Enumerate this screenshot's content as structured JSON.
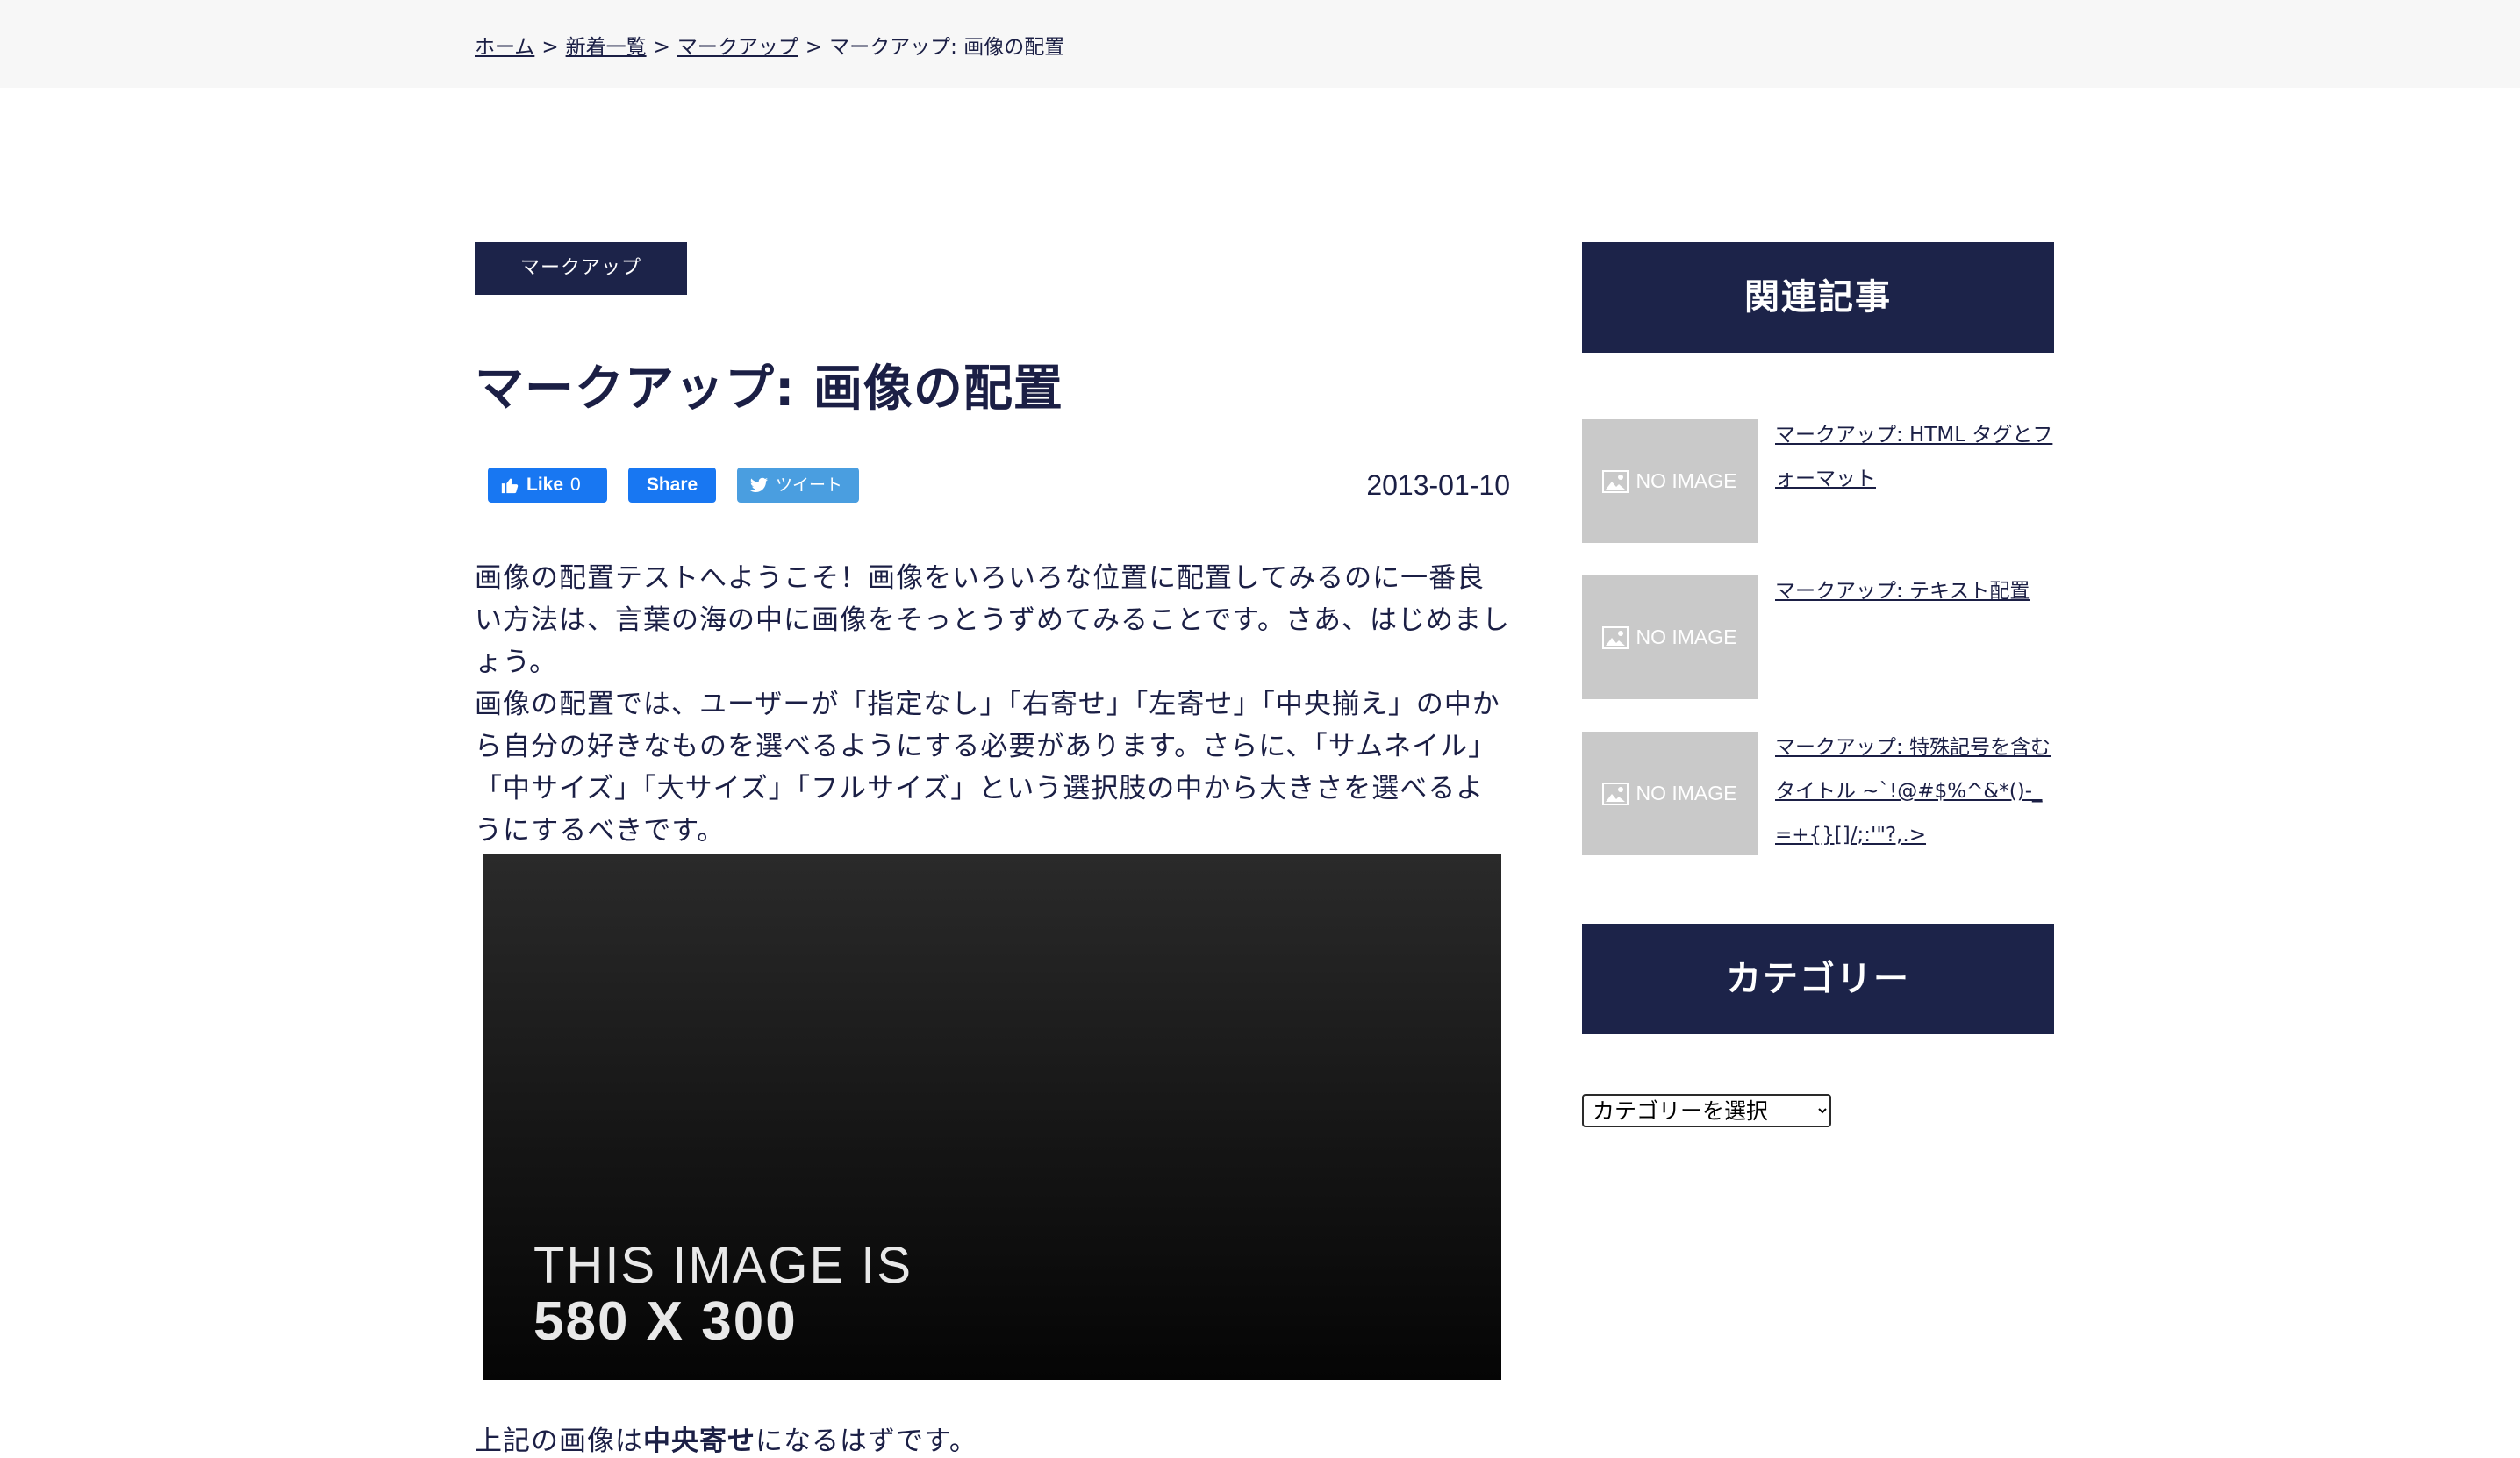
{
  "breadcrumb": {
    "items": [
      "ホーム",
      "新着一覧",
      "マークアップ"
    ],
    "current": "マークアップ: 画像の配置",
    "separator": ">"
  },
  "post": {
    "category": "マークアップ",
    "title": "マークアップ: 画像の配置",
    "date": "2013-01-10",
    "share": {
      "like_label": "Like",
      "like_count": "0",
      "share_label": "Share",
      "tweet_label": "ツイート"
    },
    "paragraphs": [
      "画像の配置テストへようこそ！画像をいろいろな位置に配置してみるのに一番良い方法は、言葉の海の中に画像をそっとうずめてみることです。さあ、はじめましょう。",
      "画像の配置では、ユーザーが「指定なし」「右寄せ」「左寄せ」「中央揃え」の中から自分の好きなものを選べるようにする必要があります。さらに、「サムネイル」「中サイズ」「大サイズ」「フルサイズ」という選択肢の中から大きさを選べるようにするべきです。"
    ],
    "image": {
      "line1": "THIS IMAGE IS",
      "line2": "580 X 300"
    },
    "after_text": {
      "before": "上記の画像は",
      "bold": "中央寄せ",
      "after": "になるはずです。"
    }
  },
  "sidebar": {
    "related_heading": "関連記事",
    "no_image_label": "NO IMAGE",
    "related": [
      {
        "title": "マークアップ: HTML タグとフォーマット"
      },
      {
        "title": "マークアップ: テキスト配置"
      },
      {
        "title": "マークアップ: 特殊記号を含むタイトル ~`!@#$%^&*()-_=+{}[]/;:'\"?,.>"
      }
    ],
    "category_heading": "カテゴリー",
    "category_select": "カテゴリーを選択"
  },
  "colors": {
    "navy": "#1c2349",
    "text": "#1b1f45",
    "facebook": "#1877f2",
    "twitter": "#4a9ee0",
    "thumb_gray": "#c9c9c9",
    "breadcrumb_bg": "#f7f7f7"
  }
}
